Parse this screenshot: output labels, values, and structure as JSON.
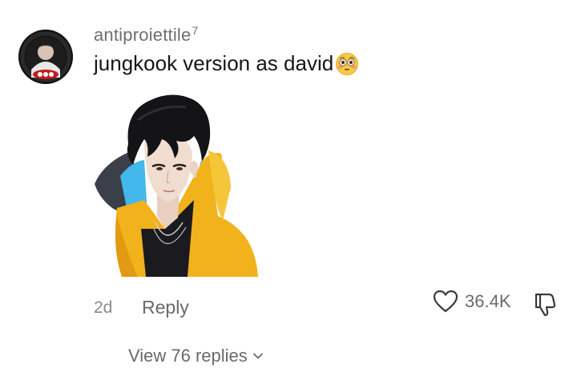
{
  "comment": {
    "username": "antiproiettile",
    "username_superscript": "7",
    "text": "jungkook version as david",
    "emoji": "flushed-face-emoji",
    "timestamp": "2d",
    "reply_label": "Reply",
    "like_count": "36.4K",
    "view_replies_label": "View 76 replies"
  },
  "colors": {
    "username": "#6f6f6f",
    "text": "#161616",
    "meta": "#6a6a6a",
    "jacket": "#f2b21c",
    "hood_lining": "#3fb6ef"
  }
}
